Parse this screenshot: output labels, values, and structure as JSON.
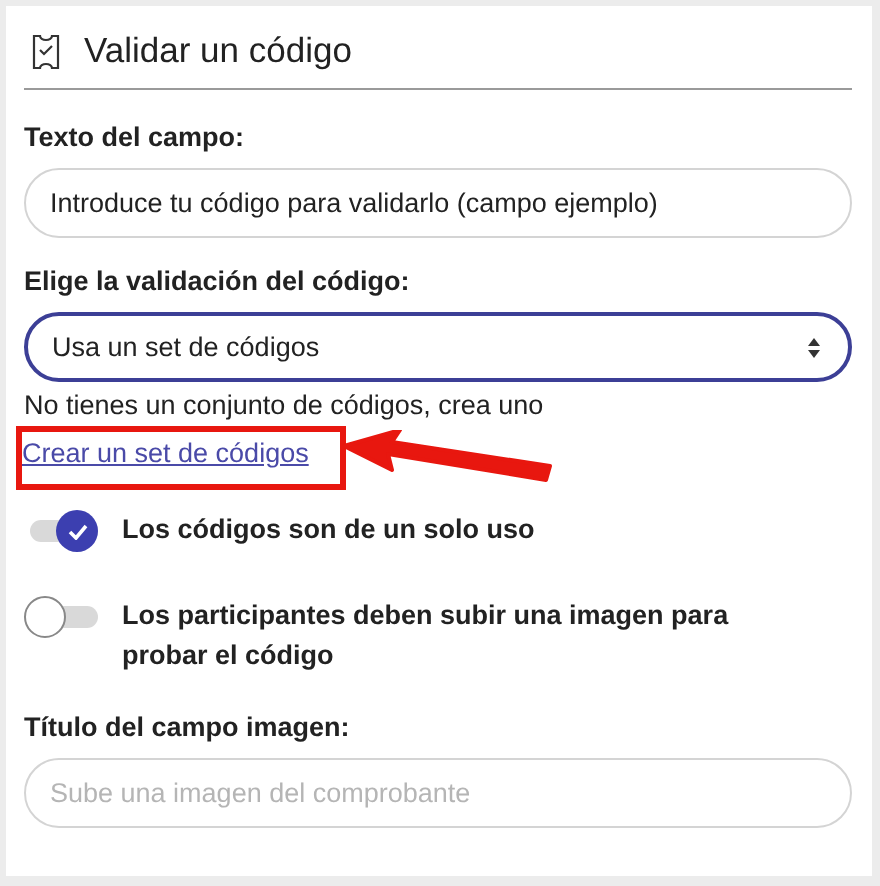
{
  "header": {
    "title": "Validar un código"
  },
  "text_field": {
    "label": "Texto del campo:",
    "value": "Introduce tu código para validarlo (campo ejemplo)"
  },
  "validation": {
    "label": "Elige la validación del código:",
    "value": "Usa un set de códigos",
    "focused": true
  },
  "helper": "No tienes un conjunto de códigos, crea uno",
  "link": {
    "label": "Crear un set de códigos",
    "highlighted": true
  },
  "toggles": [
    {
      "label": "Los códigos son de un solo uso",
      "on": true
    },
    {
      "label": "Los participantes deben subir una imagen para probar el código",
      "on": false
    }
  ],
  "image_field": {
    "label": "Título del campo imagen:",
    "placeholder": "Sube una imagen del comprobante"
  }
}
